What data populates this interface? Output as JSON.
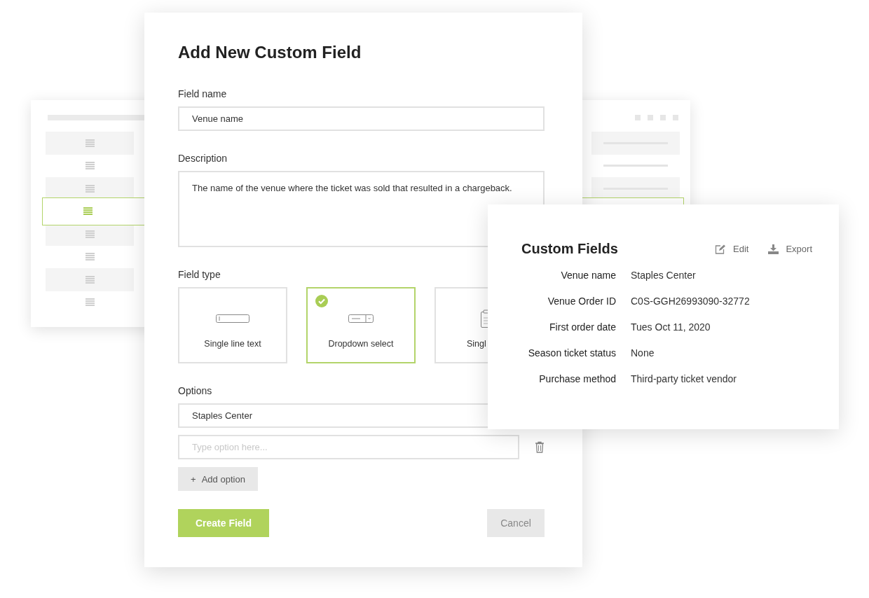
{
  "background_table": {
    "rows": [
      {
        "selected": false
      },
      {
        "selected": false
      },
      {
        "selected": false
      },
      {
        "selected": true
      },
      {
        "selected": false
      },
      {
        "selected": false
      },
      {
        "selected": false
      },
      {
        "selected": false
      }
    ]
  },
  "dialog": {
    "title": "Add New Custom Field",
    "field_name": {
      "label": "Field name",
      "value": "Venue name"
    },
    "description": {
      "label": "Description",
      "value": "The name of the venue where the ticket was sold that resulted in a chargeback."
    },
    "field_type": {
      "label": "Field type",
      "options": [
        {
          "kind": "text",
          "label": "Single line text",
          "selected": false
        },
        {
          "kind": "dropdown",
          "label": "Dropdown select",
          "selected": true
        },
        {
          "kind": "clipboard",
          "label": "Singl",
          "selected": false
        }
      ]
    },
    "options": {
      "label": "Options",
      "value": "Staples Center",
      "placeholder": "Type option here...",
      "add_button": "Add option",
      "add_icon": "+"
    },
    "buttons": {
      "create": "Create Field",
      "cancel": "Cancel"
    }
  },
  "custom_fields": {
    "title": "Custom Fields",
    "actions": [
      {
        "kind": "edit",
        "label": "Edit"
      },
      {
        "kind": "export",
        "label": "Export"
      }
    ],
    "rows": [
      {
        "label": "Venue name",
        "value": "Staples Center"
      },
      {
        "label": "Venue Order ID",
        "value": "C0S-GGH26993090-32772"
      },
      {
        "label": "First order date",
        "value": "Tues Oct 11, 2020"
      },
      {
        "label": "Season ticket status",
        "value": "None"
      },
      {
        "label": "Purchase method",
        "value": "Third-party ticket vendor"
      }
    ]
  }
}
